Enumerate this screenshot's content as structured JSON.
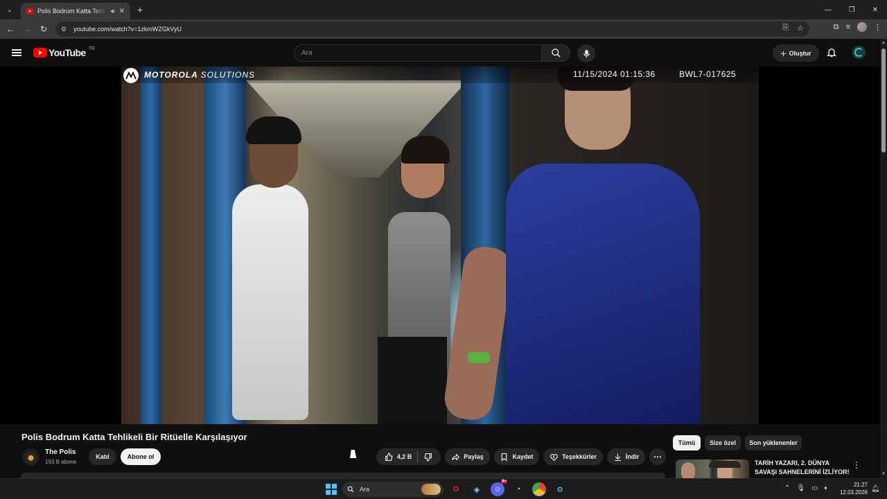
{
  "browser": {
    "tab_title": "Polis Bodrum Katta Tehlikeli Bir Ritüelle Karşılaşıyor - YouTube",
    "url": "youtube.com/watch?v=1zkmWZGkVyU",
    "icons": [
      "chevron-down-icon",
      "speaker-icon",
      "close-icon",
      "plus-icon",
      "back-icon",
      "forward-icon",
      "reload-icon",
      "site-info-icon",
      "install-icon",
      "star-icon",
      "extensions-icon",
      "media-icon",
      "profile-avatar",
      "menu-dots-icon"
    ]
  },
  "youtube": {
    "logo_text": "YouTube",
    "country_code": "TR",
    "search_placeholder": "Ara",
    "create_label": "Oluştur"
  },
  "video": {
    "overlay_brand_bold": "MOTOROLA",
    "overlay_brand_light": "SOLUTIONS",
    "timestamp": "11/15/2024 01:15:36",
    "device_id": "BWL7-017625",
    "title": "Polis Bodrum Katta Tehlikeli Bir Ritüelle Karşılaşıyor"
  },
  "channel": {
    "name": "The Polis",
    "subscribers": "193 B abone",
    "join_label": "Katıl",
    "subscribe_label": "Abone ol"
  },
  "actions": {
    "like_count": "4,2 B",
    "share_label": "Paylaş",
    "save_label": "Kaydet",
    "thanks_label": "Teşekkürler",
    "download_label": "İndir"
  },
  "sidebar": {
    "chips": [
      "Tümü",
      "Size özel",
      "Son yüklenenler"
    ],
    "active_chip": "Tümü",
    "recommendation_title": "TARİH YAZARI, 2. DÜNYA SAVAŞI SAHNELERİNİ İZLİYOR!"
  },
  "taskbar": {
    "search_placeholder": "Ara",
    "time": "21:27",
    "date": "12.03.2026",
    "discord_badge": "9+"
  }
}
